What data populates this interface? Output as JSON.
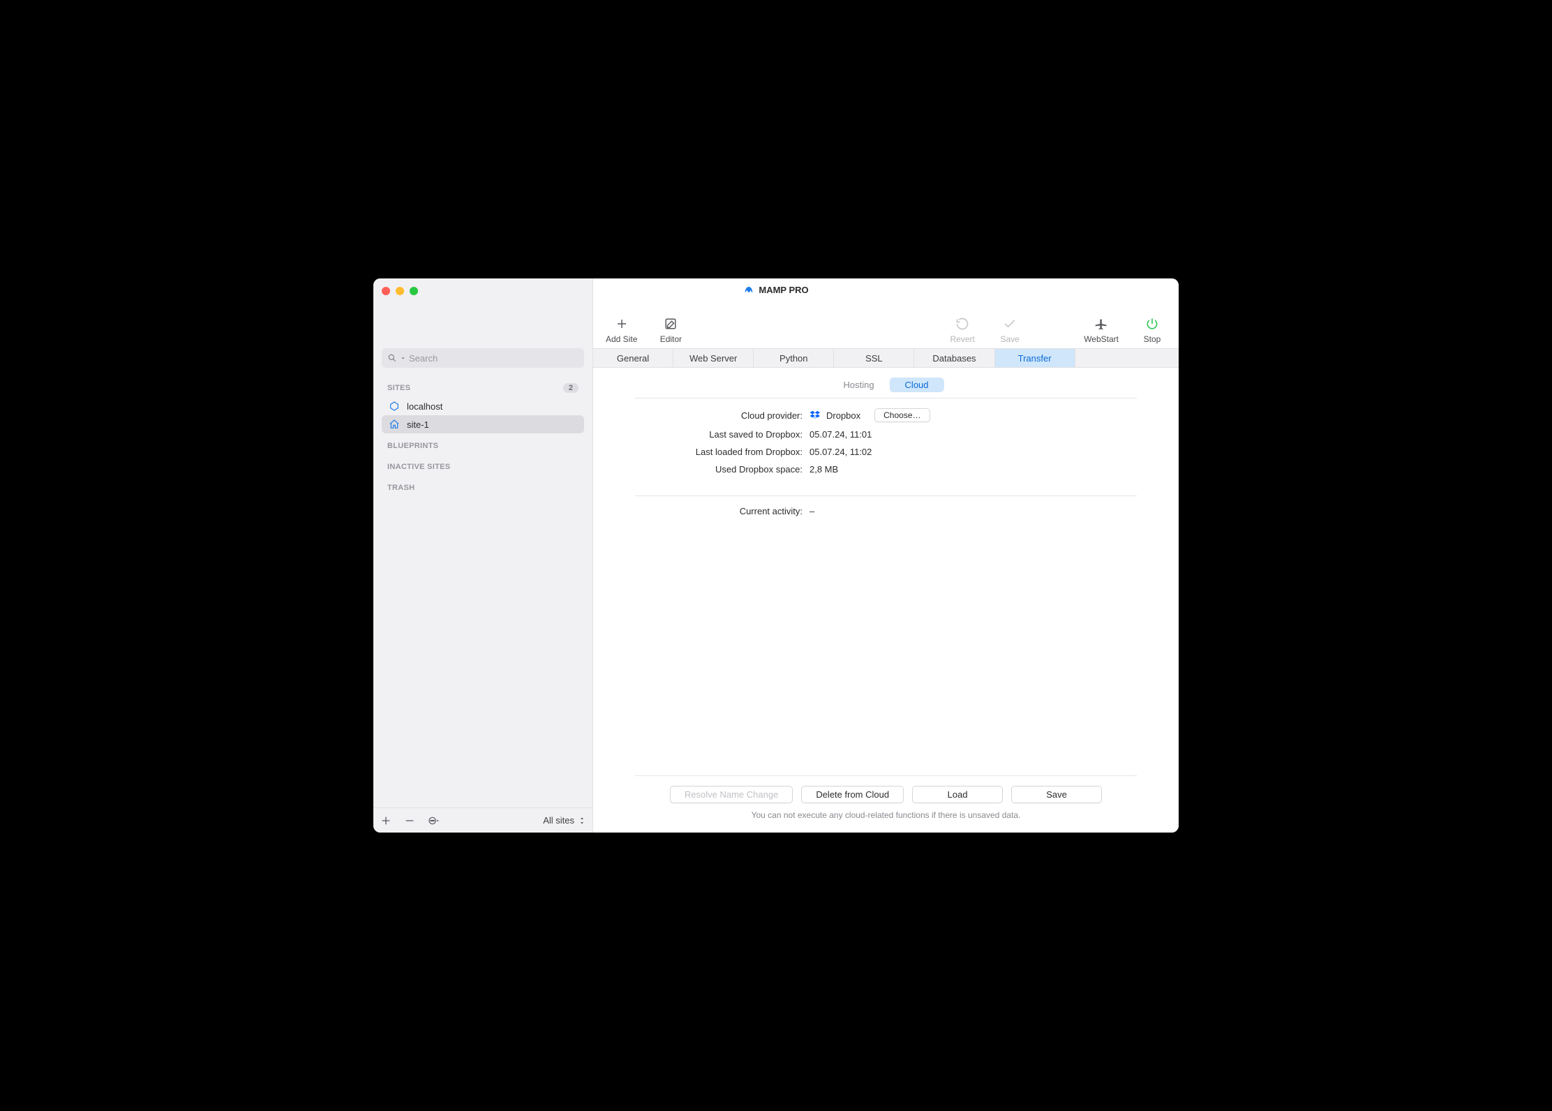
{
  "app_title": "MAMP PRO",
  "search": {
    "placeholder": "Search"
  },
  "sidebar": {
    "sections": {
      "sites": {
        "label": "SITES",
        "count": "2",
        "items": [
          {
            "label": "localhost"
          },
          {
            "label": "site-1"
          }
        ]
      },
      "blueprints": {
        "label": "BLUEPRINTS"
      },
      "inactive": {
        "label": "INACTIVE SITES"
      },
      "trash": {
        "label": "TRASH"
      }
    },
    "footer_selector": "All sites"
  },
  "toolbar": {
    "addsite": "Add Site",
    "editor": "Editor",
    "revert": "Revert",
    "save": "Save",
    "webstart": "WebStart",
    "stop": "Stop"
  },
  "tabs": {
    "general": "General",
    "webserver": "Web Server",
    "python": "Python",
    "ssl": "SSL",
    "databases": "Databases",
    "transfer": "Transfer"
  },
  "subtabs": {
    "hosting": "Hosting",
    "cloud": "Cloud"
  },
  "cloud": {
    "provider_label": "Cloud provider:",
    "provider_value": "Dropbox",
    "choose_label": "Choose…",
    "last_saved_label": "Last saved to Dropbox:",
    "last_saved_value": "05.07.24, 11:01",
    "last_loaded_label": "Last loaded from Dropbox:",
    "last_loaded_value": "05.07.24, 11:02",
    "used_space_label": "Used Dropbox space:",
    "used_space_value": "2,8 MB",
    "current_activity_label": "Current activity:",
    "current_activity_value": "–"
  },
  "buttons": {
    "resolve": "Resolve Name Change",
    "delete": "Delete from Cloud",
    "load": "Load",
    "save": "Save"
  },
  "footnote": "You can not execute any cloud-related functions if there is unsaved data."
}
